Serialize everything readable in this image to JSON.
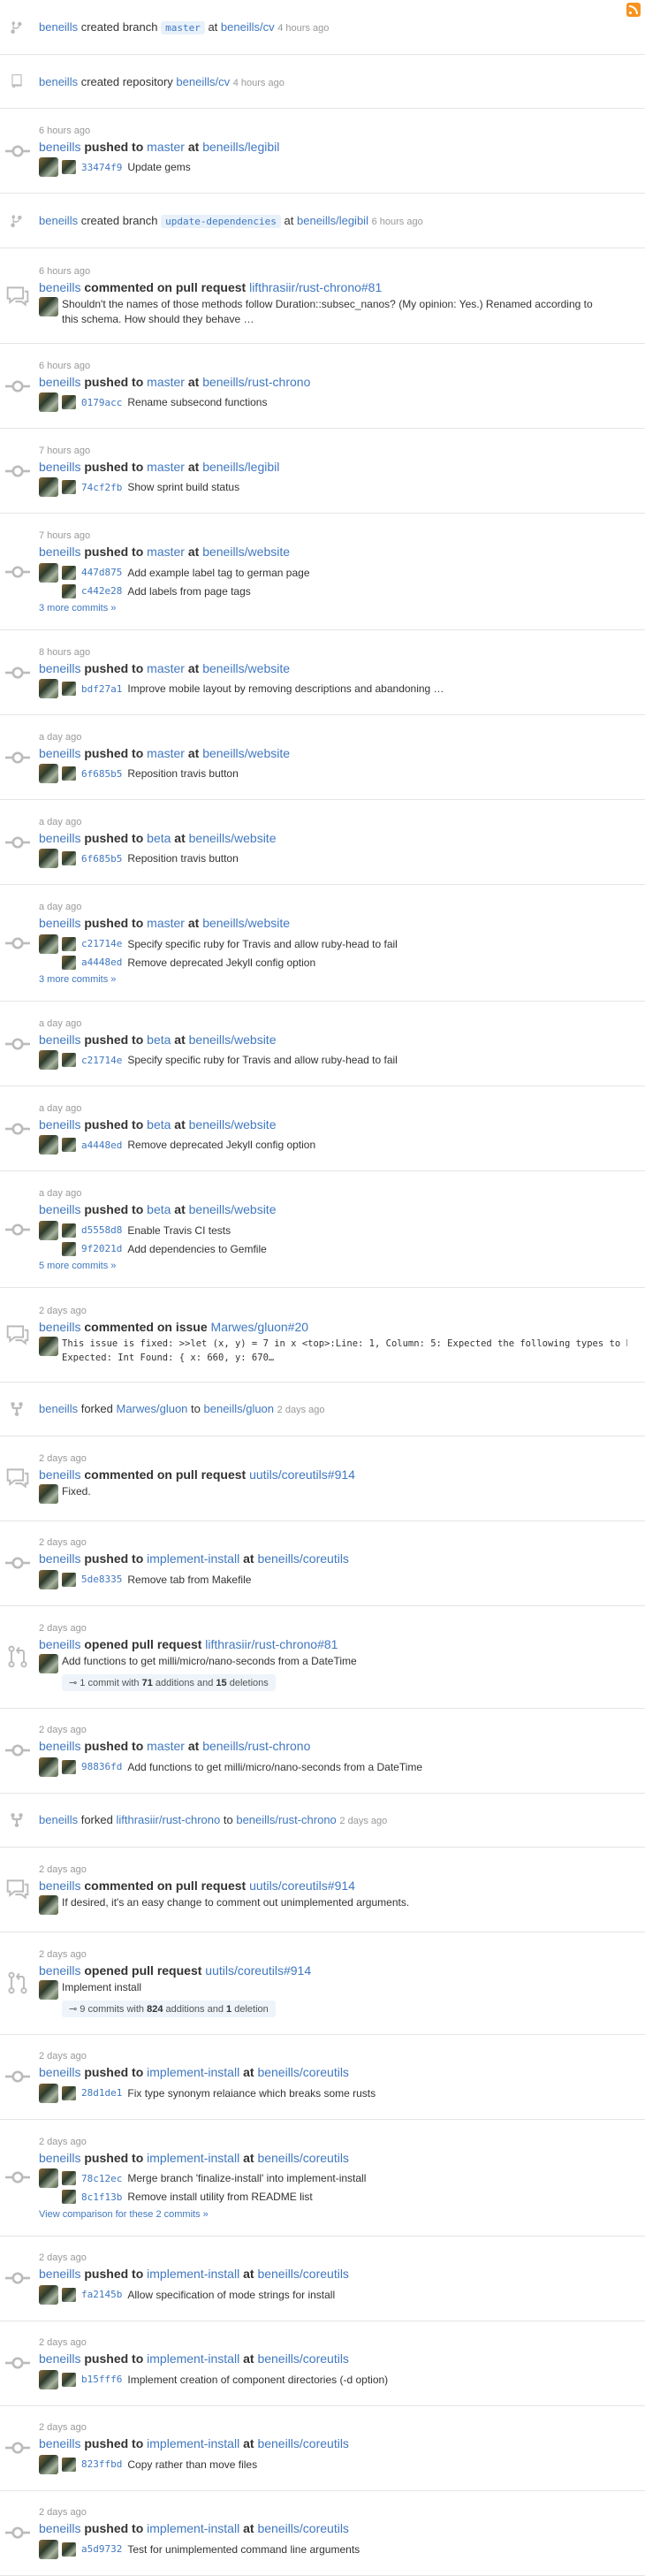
{
  "user": "beneills",
  "items": [
    {
      "kind": "create",
      "icon": "git-branch-icon",
      "pre": "created branch",
      "tag": "master",
      "mid": "at",
      "repo": "beneills/cv",
      "time": "4 hours ago"
    },
    {
      "kind": "create",
      "icon": "repo-icon",
      "pre": "created repository",
      "tag": "",
      "mid": "",
      "repo": "beneills/cv",
      "time": "4 hours ago"
    },
    {
      "kind": "push",
      "time": "6 hours ago",
      "branch": "master",
      "repo": "beneills/legibil",
      "commits": [
        {
          "sha": "33474f9",
          "msg": "Update gems"
        }
      ],
      "more": ""
    },
    {
      "kind": "create",
      "icon": "git-branch-icon",
      "pre": "created branch",
      "tag": "update-dependencies",
      "mid": "at",
      "repo": "beneills/legibil",
      "time": "6 hours ago"
    },
    {
      "kind": "comment",
      "time": "6 hours ago",
      "action": "commented on pull request",
      "target": "lifthrasiir/rust-chrono#81",
      "body": "Shouldn't the names of those methods follow Duration::subsec_nanos? (My opinion: Yes.) Renamed according to this schema. How should they behave …",
      "code": false
    },
    {
      "kind": "push",
      "time": "6 hours ago",
      "branch": "master",
      "repo": "beneills/rust-chrono",
      "commits": [
        {
          "sha": "0179acc",
          "msg": "Rename subsecond functions"
        }
      ],
      "more": ""
    },
    {
      "kind": "push",
      "time": "7 hours ago",
      "branch": "master",
      "repo": "beneills/legibil",
      "commits": [
        {
          "sha": "74cf2fb",
          "msg": "Show sprint build status"
        }
      ],
      "more": ""
    },
    {
      "kind": "push",
      "time": "7 hours ago",
      "branch": "master",
      "repo": "beneills/website",
      "commits": [
        {
          "sha": "447d875",
          "msg": "Add example label tag to german page"
        },
        {
          "sha": "c442e28",
          "msg": "Add labels from page tags"
        }
      ],
      "more": "3 more commits »"
    },
    {
      "kind": "push",
      "time": "8 hours ago",
      "branch": "master",
      "repo": "beneills/website",
      "commits": [
        {
          "sha": "bdf27a1",
          "msg": "Improve mobile layout by removing descriptions and abandoning …"
        }
      ],
      "more": ""
    },
    {
      "kind": "push",
      "time": "a day ago",
      "branch": "master",
      "repo": "beneills/website",
      "commits": [
        {
          "sha": "6f685b5",
          "msg": "Reposition travis button"
        }
      ],
      "more": ""
    },
    {
      "kind": "push",
      "time": "a day ago",
      "branch": "beta",
      "repo": "beneills/website",
      "commits": [
        {
          "sha": "6f685b5",
          "msg": "Reposition travis button"
        }
      ],
      "more": ""
    },
    {
      "kind": "push",
      "time": "a day ago",
      "branch": "master",
      "repo": "beneills/website",
      "commits": [
        {
          "sha": "c21714e",
          "msg": "Specify specific ruby for Travis and allow ruby-head to fail"
        },
        {
          "sha": "a4448ed",
          "msg": "Remove deprecated Jekyll config option"
        }
      ],
      "more": "3 more commits »"
    },
    {
      "kind": "push",
      "time": "a day ago",
      "branch": "beta",
      "repo": "beneills/website",
      "commits": [
        {
          "sha": "c21714e",
          "msg": "Specify specific ruby for Travis and allow ruby-head to fail"
        }
      ],
      "more": ""
    },
    {
      "kind": "push",
      "time": "a day ago",
      "branch": "beta",
      "repo": "beneills/website",
      "commits": [
        {
          "sha": "a4448ed",
          "msg": "Remove deprecated Jekyll config option"
        }
      ],
      "more": ""
    },
    {
      "kind": "push",
      "time": "a day ago",
      "branch": "beta",
      "repo": "beneills/website",
      "commits": [
        {
          "sha": "d5558d8",
          "msg": "Enable Travis CI tests"
        },
        {
          "sha": "9f2021d",
          "msg": "Add dependencies to Gemfile"
        }
      ],
      "more": "5 more commits »"
    },
    {
      "kind": "comment",
      "time": "2 days ago",
      "action": "commented on issue",
      "target": "Marwes/gluon#20",
      "body": "This issue is fixed: >>let (x, y) = 7 in x <top>:Line: 1, Column: 5: Expected the following types to be equal",
      "body2": "Expected: Int Found: { x: 660, y: 670…",
      "code": true
    },
    {
      "kind": "fork",
      "src": "Marwes/gluon",
      "dst": "beneills/gluon",
      "time": "2 days ago"
    },
    {
      "kind": "comment",
      "time": "2 days ago",
      "action": "commented on pull request",
      "target": "uutils/coreutils#914",
      "body": "Fixed.",
      "code": false
    },
    {
      "kind": "push",
      "time": "2 days ago",
      "branch": "implement-install",
      "repo": "beneills/coreutils",
      "commits": [
        {
          "sha": "5de8335",
          "msg": "Remove tab from Makefile"
        }
      ],
      "more": ""
    },
    {
      "kind": "pr",
      "time": "2 days ago",
      "action": "opened pull request",
      "target": "lifthrasiir/rust-chrono#81",
      "body": "Add functions to get milli/micro/nano-seconds from a DateTime",
      "stats": {
        "commits": "1 commit with",
        "adds": "71",
        "adds_label": "additions and",
        "dels": "15",
        "dels_label": "deletions"
      }
    },
    {
      "kind": "push",
      "time": "2 days ago",
      "branch": "master",
      "repo": "beneills/rust-chrono",
      "commits": [
        {
          "sha": "98836fd",
          "msg": "Add functions to get milli/micro/nano-seconds from a DateTime"
        }
      ],
      "more": ""
    },
    {
      "kind": "fork",
      "src": "lifthrasiir/rust-chrono",
      "dst": "beneills/rust-chrono",
      "time": "2 days ago"
    },
    {
      "kind": "comment",
      "time": "2 days ago",
      "action": "commented on pull request",
      "target": "uutils/coreutils#914",
      "body": "If desired, it's an easy change to comment out unimplemented arguments.",
      "code": false
    },
    {
      "kind": "pr",
      "time": "2 days ago",
      "action": "opened pull request",
      "target": "uutils/coreutils#914",
      "body": "Implement install",
      "stats": {
        "commits": "9 commits with",
        "adds": "824",
        "adds_label": "additions and",
        "dels": "1",
        "dels_label": "deletion"
      }
    },
    {
      "kind": "push",
      "time": "2 days ago",
      "branch": "implement-install",
      "repo": "beneills/coreutils",
      "commits": [
        {
          "sha": "28d1de1",
          "msg": "Fix type synonym relaiance which breaks some rusts"
        }
      ],
      "more": ""
    },
    {
      "kind": "push",
      "time": "2 days ago",
      "branch": "implement-install",
      "repo": "beneills/coreutils",
      "commits": [
        {
          "sha": "78c12ec",
          "msg": "Merge branch 'finalize-install' into implement-install"
        },
        {
          "sha": "8c1f13b",
          "msg": "Remove install utility from README list"
        }
      ],
      "more": "View comparison for these 2 commits »"
    },
    {
      "kind": "push",
      "time": "2 days ago",
      "branch": "implement-install",
      "repo": "beneills/coreutils",
      "commits": [
        {
          "sha": "fa2145b",
          "msg": "Allow specification of mode strings for install"
        }
      ],
      "more": ""
    },
    {
      "kind": "push",
      "time": "2 days ago",
      "branch": "implement-install",
      "repo": "beneills/coreutils",
      "commits": [
        {
          "sha": "b15fff6",
          "msg": "Implement creation of component directories (-d option)"
        }
      ],
      "more": ""
    },
    {
      "kind": "push",
      "time": "2 days ago",
      "branch": "implement-install",
      "repo": "beneills/coreutils",
      "commits": [
        {
          "sha": "823ffbd",
          "msg": "Copy rather than move files"
        }
      ],
      "more": ""
    },
    {
      "kind": "push",
      "time": "2 days ago",
      "branch": "implement-install",
      "repo": "beneills/coreutils",
      "commits": [
        {
          "sha": "a5d9732",
          "msg": "Test for unimplemented command line arguments"
        }
      ],
      "more": ""
    }
  ],
  "labels": {
    "pushed_to": "pushed to",
    "at": "at",
    "forked": "forked",
    "to": "to"
  }
}
